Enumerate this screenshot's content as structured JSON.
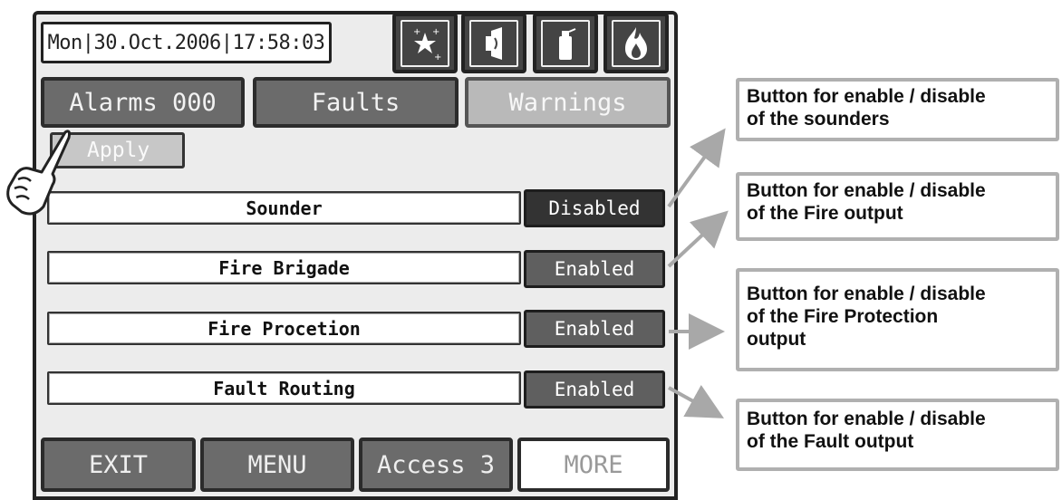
{
  "header": {
    "datetime": "Mon|30.Oct.2006|17:58:03",
    "icons": [
      "sparkle-star-icon",
      "sounder-icon",
      "extinguisher-icon",
      "fire-icon"
    ]
  },
  "tabs": [
    {
      "label": "Alarms 000"
    },
    {
      "label": "Faults"
    },
    {
      "label": "Warnings"
    }
  ],
  "apply_label": "Apply",
  "rows": [
    {
      "label": "Sounder",
      "state": "Disabled"
    },
    {
      "label": "Fire Brigade",
      "state": "Enabled"
    },
    {
      "label": "Fire Procetion",
      "state": "Enabled"
    },
    {
      "label": "Fault Routing",
      "state": "Enabled"
    }
  ],
  "footer": [
    {
      "label": "EXIT"
    },
    {
      "label": "MENU"
    },
    {
      "label": "Access 3"
    },
    {
      "label": "MORE"
    }
  ],
  "annotations": [
    {
      "line1": "Button for enable / disable",
      "line2": "of the sounders"
    },
    {
      "line1": "Button for enable / disable",
      "line2": "of the Fire output"
    },
    {
      "line1": "Button for enable / disable",
      "line2": "of the Fire Protection",
      "line3": "output"
    },
    {
      "line1": "Button for enable / disable",
      "line2": "of the Fault output"
    }
  ],
  "colors": {
    "panel": "#ececec",
    "button_dark": "#5f5f5f",
    "annotation_border": "#b0b0b0"
  }
}
